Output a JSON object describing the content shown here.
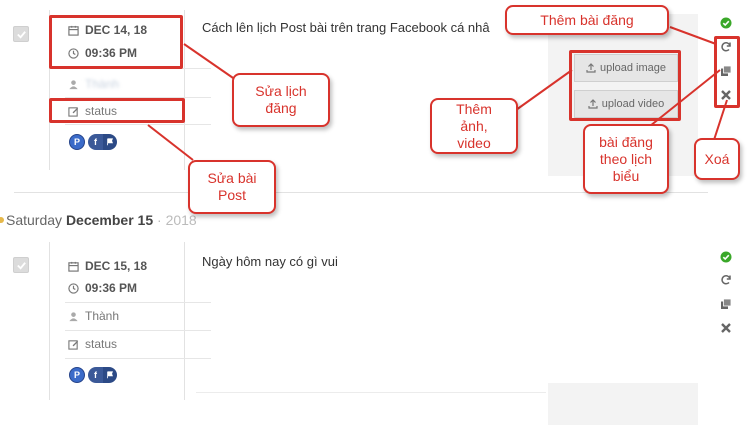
{
  "colors": {
    "annotation": "#d8332c",
    "ok": "#3aa829",
    "facebook": "#3b5998"
  },
  "posts": [
    {
      "date": "DEC 14, 18",
      "time": "09:36 PM",
      "author": "Thành",
      "status": "status",
      "text": "Cách lên lịch Post bài trên trang Facebook cá nhâ",
      "upload_image": "upload image",
      "upload_video": "upload video"
    },
    {
      "date": "DEC 15, 18",
      "time": "09:36 PM",
      "author": "Thành",
      "status": "status",
      "text": "Ngày hôm nay có gì vui"
    }
  ],
  "day_header": {
    "weekday": "Saturday",
    "month_day": "December 15",
    "year": "2018",
    "separator": "·"
  },
  "network_badges": {
    "pinterest": "P",
    "facebook": "f"
  },
  "icons": [
    "calendar-icon",
    "clock-icon",
    "user-icon",
    "edit-icon",
    "upload-icon",
    "check-circle-icon",
    "refresh-icon",
    "copy-icon",
    "close-icon"
  ],
  "annotations": {
    "them_bai_dang": "Thêm bài đăng",
    "sua_lich_dang": "Sửa lịch đăng",
    "them_anh_video": "Thêm ảnh, video",
    "sua_bai_post": "Sửa bài Post",
    "bai_dang_theo_lich": "bài đăng theo lịch biểu",
    "xoa": "Xoá"
  }
}
